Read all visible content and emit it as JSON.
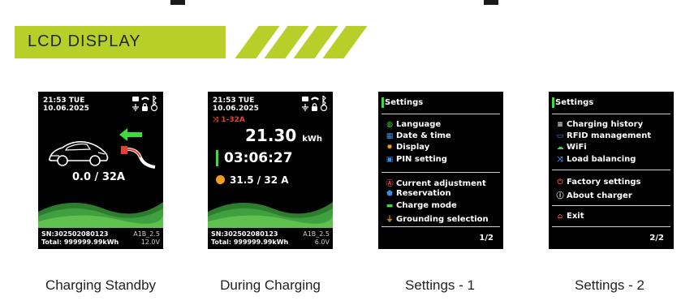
{
  "section_title": "LCD DISPLAY",
  "captions": {
    "standby": "Charging Standby",
    "charging": "During Charging",
    "settings1": "Settings - 1",
    "settings2": "Settings - 2"
  },
  "standby": {
    "time": "21:53  TUE",
    "date": "10.06.2025",
    "current": "0.0 / 32A",
    "sn": "SN:302502080123",
    "model": "A1B_2.5",
    "total": "Total: 999999.99kWh",
    "voltage": "12.0V"
  },
  "charging": {
    "time": "21:53  TUE",
    "date": "10.06.2025",
    "mode": "1-32A",
    "energy": "21.30",
    "energy_unit": "kWh",
    "duration": "03:06:27",
    "current": "31.5 / 32 A",
    "sn": "SN:302502080123",
    "model": "A1B_2.5",
    "total": "Total: 999999.99kWh",
    "voltage": "6.0V"
  },
  "settings1": {
    "title": "Settings",
    "items": [
      {
        "label": "Language",
        "icon": "globe-icon",
        "color": "#3ddc3d"
      },
      {
        "label": "Date & time",
        "icon": "calendar-icon",
        "color": "#3a8fe8"
      },
      {
        "label": "Display",
        "icon": "sun-icon",
        "color": "#f0a020"
      },
      {
        "label": "PIN setting",
        "icon": "lock-icon",
        "color": "#3a8fe8"
      },
      {
        "label": "Current adjustment",
        "icon": "ampere-icon",
        "color": "#e84040"
      },
      {
        "label": "Reservation",
        "icon": "shield-icon",
        "color": "#3a8fe8"
      },
      {
        "label": "Charge mode",
        "icon": "battery-icon",
        "color": "#3ddc3d"
      },
      {
        "label": "Grounding selection",
        "icon": "ground-icon",
        "color": "#f0a020"
      }
    ],
    "page": "1/2"
  },
  "settings2": {
    "title": "Settings",
    "items": [
      {
        "label": "Charging history",
        "icon": "list-icon",
        "color": "#ffffff"
      },
      {
        "label": "RFID management",
        "icon": "card-icon",
        "color": "#3a8fe8"
      },
      {
        "label": "WiFi",
        "icon": "cloud-icon",
        "color": "#3ddc3d"
      },
      {
        "label": "Load balancing",
        "icon": "shuffle-icon",
        "color": "#3a8fe8"
      },
      {
        "label": "Factory settings",
        "icon": "power-icon",
        "color": "#f05030"
      },
      {
        "label": "About charger",
        "icon": "info-icon",
        "color": "#ffffff"
      },
      {
        "label": "Exit",
        "icon": "home-icon",
        "color": "#f05030"
      }
    ],
    "page": "2/2"
  }
}
